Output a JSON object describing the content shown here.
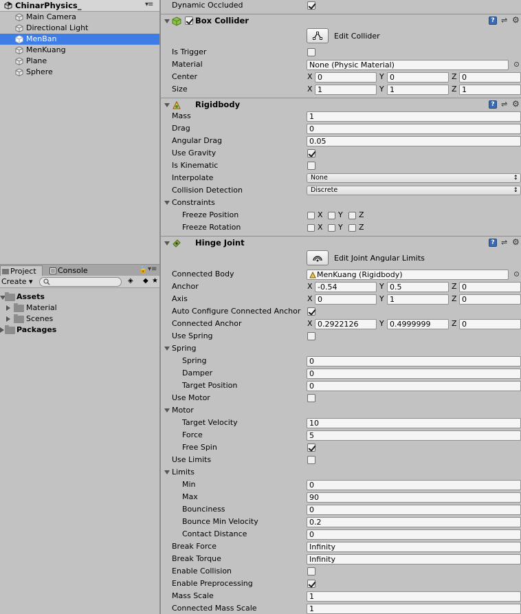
{
  "hierarchy": {
    "scene_name": "ChinarPhysics_",
    "items": [
      "Main Camera",
      "Directional Light",
      "MenBan",
      "MenKuang",
      "Plane",
      "Sphere"
    ],
    "selected": "MenBan"
  },
  "project_panel": {
    "tabs": [
      "Project",
      "Console"
    ],
    "create_label": "Create",
    "assets_label": "Assets",
    "folders": [
      "Material",
      "Scenes"
    ],
    "packages_label": "Packages"
  },
  "inspector": {
    "dynamic_occluded": {
      "label": "Dynamic Occluded",
      "checked": true
    },
    "box_collider": {
      "title": "Box Collider",
      "edit_label": "Edit Collider",
      "is_trigger": {
        "label": "Is Trigger",
        "checked": false
      },
      "material": {
        "label": "Material",
        "value": "None (Physic Material)"
      },
      "center": {
        "label": "Center",
        "x": "0",
        "y": "0",
        "z": "0"
      },
      "size": {
        "label": "Size",
        "x": "1",
        "y": "1",
        "z": "1"
      }
    },
    "rigidbody": {
      "title": "Rigidbody",
      "mass": {
        "label": "Mass",
        "value": "1"
      },
      "drag": {
        "label": "Drag",
        "value": "0"
      },
      "angular_drag": {
        "label": "Angular Drag",
        "value": "0.05"
      },
      "use_gravity": {
        "label": "Use Gravity",
        "checked": true
      },
      "is_kinematic": {
        "label": "Is Kinematic",
        "checked": false
      },
      "interpolate": {
        "label": "Interpolate",
        "value": "None"
      },
      "collision_detection": {
        "label": "Collision Detection",
        "value": "Discrete"
      },
      "constraints": {
        "label": "Constraints"
      },
      "freeze_position": {
        "label": "Freeze Position"
      },
      "freeze_rotation": {
        "label": "Freeze Rotation"
      }
    },
    "hinge_joint": {
      "title": "Hinge Joint",
      "edit_label": "Edit Joint Angular Limits",
      "connected_body": {
        "label": "Connected Body",
        "value": "MenKuang (Rigidbody)"
      },
      "anchor": {
        "label": "Anchor",
        "x": "-0.54",
        "y": "0.5",
        "z": "0"
      },
      "axis": {
        "label": "Axis",
        "x": "0",
        "y": "1",
        "z": "0"
      },
      "auto_configure": {
        "label": "Auto Configure Connected Anchor",
        "checked": true
      },
      "connected_anchor": {
        "label": "Connected Anchor",
        "x": "0.2922126",
        "y": "0.4999999",
        "z": "0"
      },
      "use_spring": {
        "label": "Use Spring",
        "checked": false
      },
      "spring_section": {
        "label": "Spring"
      },
      "spring": {
        "label": "Spring",
        "value": "0"
      },
      "damper": {
        "label": "Damper",
        "value": "0"
      },
      "target_position": {
        "label": "Target Position",
        "value": "0"
      },
      "use_motor": {
        "label": "Use Motor",
        "checked": false
      },
      "motor_section": {
        "label": "Motor"
      },
      "target_velocity": {
        "label": "Target Velocity",
        "value": "10"
      },
      "force": {
        "label": "Force",
        "value": "5"
      },
      "free_spin": {
        "label": "Free Spin",
        "checked": true
      },
      "use_limits": {
        "label": "Use Limits",
        "checked": false
      },
      "limits_section": {
        "label": "Limits"
      },
      "min": {
        "label": "Min",
        "value": "0"
      },
      "max": {
        "label": "Max",
        "value": "90"
      },
      "bounciness": {
        "label": "Bounciness",
        "value": "0"
      },
      "bounce_min_velocity": {
        "label": "Bounce Min Velocity",
        "value": "0.2"
      },
      "contact_distance": {
        "label": "Contact Distance",
        "value": "0"
      },
      "break_force": {
        "label": "Break Force",
        "value": "Infinity"
      },
      "break_torque": {
        "label": "Break Torque",
        "value": "Infinity"
      },
      "enable_collision": {
        "label": "Enable Collision",
        "checked": false
      },
      "enable_preprocessing": {
        "label": "Enable Preprocessing",
        "checked": true
      },
      "mass_scale": {
        "label": "Mass Scale",
        "value": "1"
      },
      "connected_mass_scale": {
        "label": "Connected Mass Scale",
        "value": "1"
      }
    }
  },
  "axis_letters": {
    "x": "X",
    "y": "Y",
    "z": "Z"
  },
  "colors": {
    "selection": "#3e7ce6",
    "panel": "#c2c2c2",
    "help_icon": "#3a6bb0"
  }
}
